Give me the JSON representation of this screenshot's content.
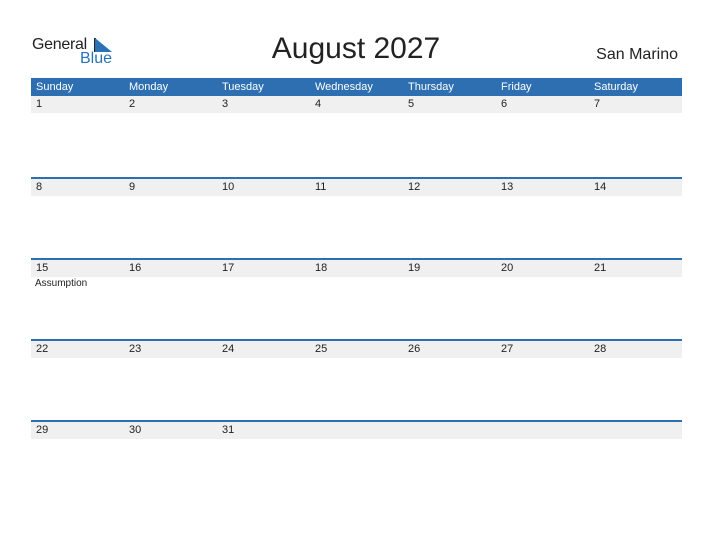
{
  "logo": {
    "general": "General",
    "blue": "Blue"
  },
  "title": "August 2027",
  "country": "San Marino",
  "colors": {
    "accent": "#2e6fb1",
    "date_strip": "#f0f0f0"
  },
  "weekdays": [
    "Sunday",
    "Monday",
    "Tuesday",
    "Wednesday",
    "Thursday",
    "Friday",
    "Saturday"
  ],
  "weeks": [
    [
      {
        "day": "1",
        "event": ""
      },
      {
        "day": "2",
        "event": ""
      },
      {
        "day": "3",
        "event": ""
      },
      {
        "day": "4",
        "event": ""
      },
      {
        "day": "5",
        "event": ""
      },
      {
        "day": "6",
        "event": ""
      },
      {
        "day": "7",
        "event": ""
      }
    ],
    [
      {
        "day": "8",
        "event": ""
      },
      {
        "day": "9",
        "event": ""
      },
      {
        "day": "10",
        "event": ""
      },
      {
        "day": "11",
        "event": ""
      },
      {
        "day": "12",
        "event": ""
      },
      {
        "day": "13",
        "event": ""
      },
      {
        "day": "14",
        "event": ""
      }
    ],
    [
      {
        "day": "15",
        "event": "Assumption"
      },
      {
        "day": "16",
        "event": ""
      },
      {
        "day": "17",
        "event": ""
      },
      {
        "day": "18",
        "event": ""
      },
      {
        "day": "19",
        "event": ""
      },
      {
        "day": "20",
        "event": ""
      },
      {
        "day": "21",
        "event": ""
      }
    ],
    [
      {
        "day": "22",
        "event": ""
      },
      {
        "day": "23",
        "event": ""
      },
      {
        "day": "24",
        "event": ""
      },
      {
        "day": "25",
        "event": ""
      },
      {
        "day": "26",
        "event": ""
      },
      {
        "day": "27",
        "event": ""
      },
      {
        "day": "28",
        "event": ""
      }
    ],
    [
      {
        "day": "29",
        "event": ""
      },
      {
        "day": "30",
        "event": ""
      },
      {
        "day": "31",
        "event": ""
      },
      {
        "day": "",
        "event": ""
      },
      {
        "day": "",
        "event": ""
      },
      {
        "day": "",
        "event": ""
      },
      {
        "day": "",
        "event": ""
      }
    ]
  ]
}
